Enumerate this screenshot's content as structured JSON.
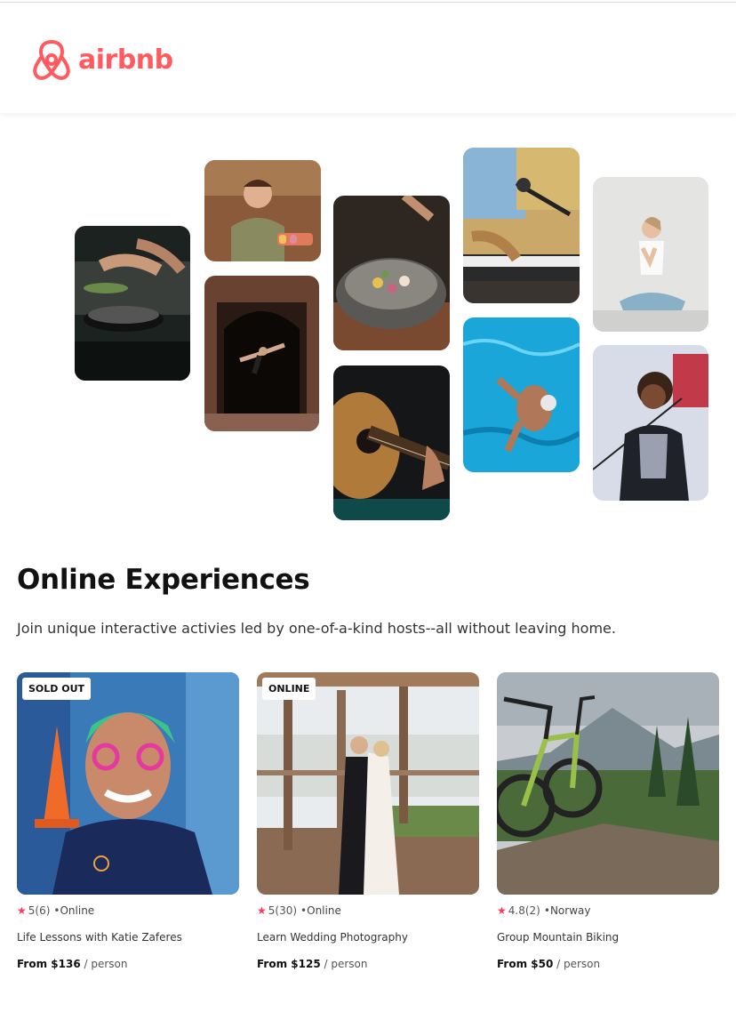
{
  "brand": {
    "name": "airbnb",
    "color": "#FF5A5F"
  },
  "collage": [
    {
      "subject": "chef cooking in kitchen"
    },
    {
      "subject": "woman holding macarons"
    },
    {
      "subject": "dancer in archway"
    },
    {
      "subject": "plated gourmet dish"
    },
    {
      "subject": "acoustic guitar"
    },
    {
      "subject": "keyboard and microphone"
    },
    {
      "subject": "swimmer in pool"
    },
    {
      "subject": "yoga pose"
    },
    {
      "subject": "singer with microphone"
    }
  ],
  "section": {
    "title": "Online Experiences",
    "subtitle": "Join unique interactive activies led by one-of-a-kind hosts--all without leaving home."
  },
  "cards": [
    {
      "badge": "SOLD OUT",
      "rating": "5",
      "reviews": "(6)",
      "location": "Online",
      "title": "Life Lessons with Katie Zaferes",
      "price": "From $136",
      "unit": "person"
    },
    {
      "badge": "ONLINE",
      "rating": "5",
      "reviews": "(30)",
      "location": "Online",
      "title": "Learn Wedding Photography",
      "price": "From $125",
      "unit": "person"
    },
    {
      "badge": "",
      "rating": "4.8",
      "reviews": "(2)",
      "location": "Norway",
      "title": "Group Mountain Biking",
      "price": "From $50",
      "unit": "person"
    }
  ],
  "labels": {
    "star": "★",
    "dot": "•",
    "slash": " / "
  }
}
